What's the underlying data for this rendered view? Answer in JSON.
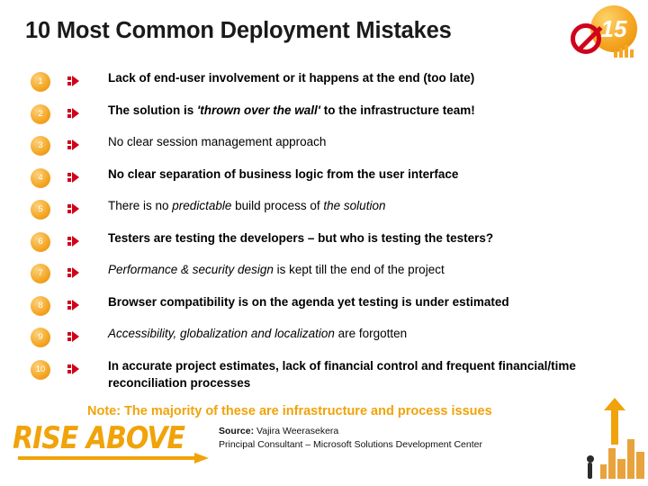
{
  "slide": {
    "title": "10 Most Common Deployment Mistakes",
    "logo": {
      "circle_text": "15",
      "no_sign_icon": "prohibition-icon"
    },
    "items": [
      {
        "number": "1",
        "text": "Lack of end-user involvement or it happens at the end (too late)",
        "bold": true
      },
      {
        "number": "2",
        "text_html": "The solution is <i>'thrown over the wall'</i> to the infrastructure team!",
        "bold": true
      },
      {
        "number": "3",
        "text": "No clear session management approach",
        "bold": false
      },
      {
        "number": "4",
        "text": "No clear separation of business logic from the user interface",
        "bold": true
      },
      {
        "number": "5",
        "text_html": "There is no <i>predictable</i> build process of <i>the solution</i>",
        "bold": false
      },
      {
        "number": "6",
        "text": "Testers are testing the developers – but who is testing the testers?",
        "bold": true
      },
      {
        "number": "7",
        "text_html": "<i>Performance &amp; security design</i> is kept till the end of the project",
        "bold": false
      },
      {
        "number": "8",
        "text": "Browser compatibility is on the agenda yet testing is under estimated",
        "bold": true
      },
      {
        "number": "9",
        "text_html": "<i>Accessibility, globalization and localization</i> are forgotten",
        "bold": false
      },
      {
        "number": "10",
        "text": "In accurate project estimates, lack of financial control and frequent financial/time reconciliation processes",
        "bold": true
      }
    ],
    "note": "Note: The majority of these are infrastructure and process issues",
    "source": {
      "label": "Source:",
      "name": "Vajira Weerasekera",
      "role": "Principal Consultant – Microsoft Solutions Development Center"
    },
    "wordmark": "RISE ABOVE",
    "colors": {
      "accent_orange": "#f0a30a",
      "badge_orange": "#f5a623",
      "red": "#d0021b",
      "text": "#000000"
    }
  }
}
